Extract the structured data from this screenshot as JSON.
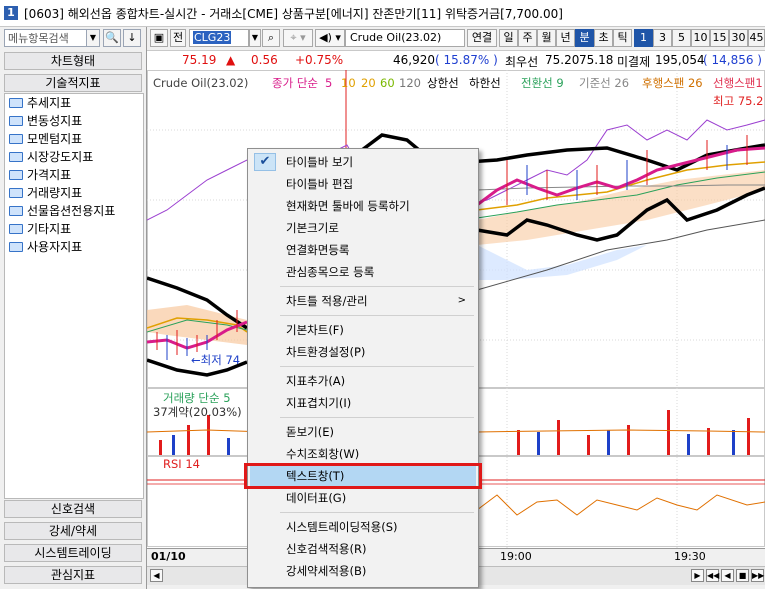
{
  "window": {
    "number_badge": "1",
    "title": "[0603] 해외선옵 종합차트-실시간 - 거래소[CME] 상품구분[에너지] 잔존만기[11] 위탁증거금[7,700.00]"
  },
  "left_panel": {
    "search_placeholder": "메뉴항목검색",
    "btn_search": "🔍",
    "btn_down": "↓",
    "header_chart_type": "차트형태",
    "header_tech_indicators": "기술적지표",
    "tree_items": [
      "추세지표",
      "변동성지표",
      "모멘텀지표",
      "시장강도지표",
      "가격지표",
      "거래량지표",
      "선물옵션전용지표",
      "기타지표",
      "사용자지표"
    ],
    "bottom_tabs": [
      "신호검색",
      "강세/약세",
      "시스템트레이딩",
      "관심지표"
    ]
  },
  "toolbar": {
    "full_label": "전",
    "symbol_code": "CLG23",
    "symbol_name": "Crude Oil(23.02)",
    "link_label": "연결",
    "periods": [
      "일",
      "주",
      "월",
      "년",
      "분",
      "초",
      "틱"
    ],
    "active_period": "분",
    "intervals": [
      "1",
      "3",
      "5",
      "10",
      "15",
      "30",
      "45"
    ],
    "active_interval": "1"
  },
  "price_strip": {
    "price": "75.19",
    "change_arrow": "▲",
    "change": "0.56",
    "change_pct": "+0.75%",
    "volume": "46,920",
    "volume_pct": "( 15.87% )",
    "best_ask_label": "최우선",
    "best_ask": "75.20",
    "best_bid": "75.18",
    "unfilled_label": "미결제",
    "open_interest": "195,054",
    "oi_change": "( 14,856 )"
  },
  "chart": {
    "legend_symbol": "Crude Oil(23.02)",
    "legend_ma": "종가 단순",
    "legend_ma_periods": [
      "5",
      "10",
      "20",
      "60",
      "120"
    ],
    "legend_upper": "상한선",
    "legend_lower": "하한선",
    "legend_tenkan": "전환선 9",
    "legend_kijun": "기준선 26",
    "legend_chikou": "후행스팬 26",
    "legend_senkou": "선행스팬1",
    "high_label": "최고 75.2",
    "low_label": "←최저 74",
    "volume_legend": "거래량 단순 5",
    "volume_sub": "37계약(20.03%)",
    "rsi_legend": "RSI 14",
    "colors": {
      "ma5": "#d81b8a",
      "ma10": "#e0a000",
      "ma20": "#7ab800",
      "ma60": "#2a8a2a",
      "ma120": "#777777",
      "tenkan": "#2aa15a",
      "kijun": "#888888",
      "chikou": "#d07000",
      "senkou": "#e03050",
      "bollinger": "#000000",
      "cloud": "#f6a25a",
      "up": "#e21b1b",
      "down": "#1e40c8"
    }
  },
  "x_axis": {
    "date": "01/10",
    "ticks": [
      "19:00",
      "19:30"
    ]
  },
  "context_menu": {
    "items": [
      {
        "label": "타이틀바 보기",
        "checked": true
      },
      {
        "label": "타이틀바 편집"
      },
      {
        "label": "현재화면 툴바에 등록하기"
      },
      {
        "label": "기본크기로"
      },
      {
        "label": "연결화면등록"
      },
      {
        "label": "관심종목으로 등록"
      },
      {
        "label": "차트틀 적용/관리",
        "submenu": true
      },
      {
        "label": "기본차트(F)"
      },
      {
        "label": "차트환경설정(P)"
      },
      {
        "label": "지표추가(A)"
      },
      {
        "label": "지표겹치기(I)"
      },
      {
        "label": "돋보기(E)"
      },
      {
        "label": "수치조회창(W)"
      },
      {
        "label": "텍스트창(T)",
        "highlighted": true
      },
      {
        "label": "데이터표(G)"
      },
      {
        "label": "시스템트레이딩적용(S)"
      },
      {
        "label": "신호검색적용(R)"
      },
      {
        "label": "강세약세적용(B)"
      }
    ]
  }
}
